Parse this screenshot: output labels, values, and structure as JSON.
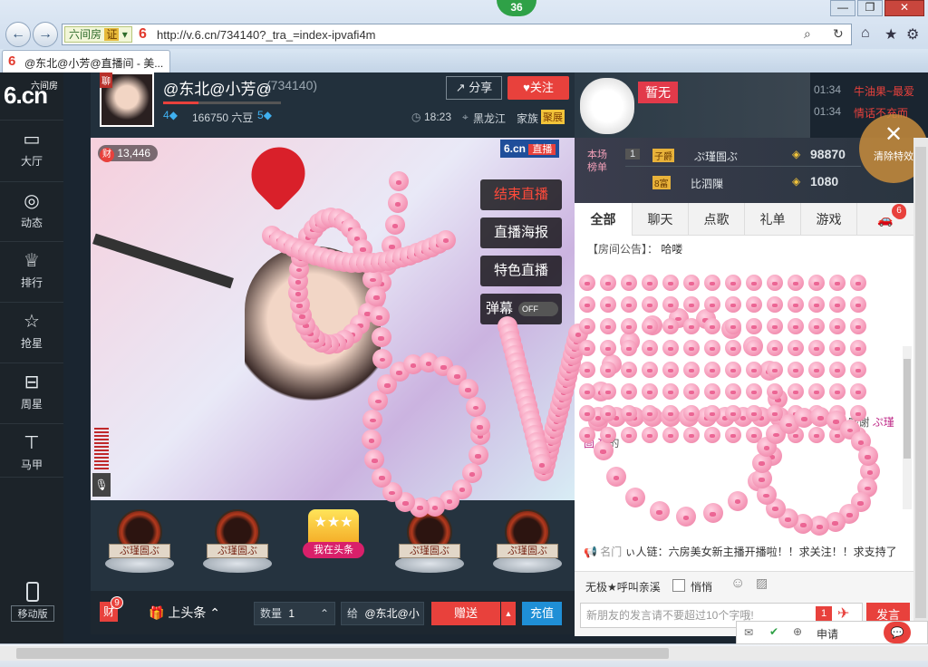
{
  "browser": {
    "badge_count": "36",
    "back_label": "←",
    "forward_label": "→",
    "site_id_label": "六间房",
    "site_id_cert": "证",
    "url": "http://v.6.cn/734140?_tra_=index-ipvafi4m",
    "tab_title": "@东北@小芳@直播间 - 美...",
    "window_controls": [
      "—",
      "❐",
      "✕"
    ]
  },
  "sidebar": {
    "logo_brand": "六间房",
    "logo_text": "6.cn",
    "items": [
      {
        "label": "大厅",
        "icon": "tv-icon"
      },
      {
        "label": "动态",
        "icon": "compass-icon"
      },
      {
        "label": "排行",
        "icon": "crown-icon"
      },
      {
        "label": "抢星",
        "icon": "star-icon"
      },
      {
        "label": "周星",
        "icon": "gift-bag-icon"
      },
      {
        "label": "马甲",
        "icon": "shirt-icon"
      }
    ],
    "mobile_label": "移动版"
  },
  "streamer": {
    "badge": "聊",
    "name": "@东北@小芳@",
    "room_id": "(734140)",
    "level_left": "4",
    "beans": "166750 六豆",
    "level_right": "5",
    "time": "18:23",
    "location": "黑龙江",
    "family_label": "家族",
    "family_badge": "聚展",
    "share_label": "分享",
    "follow_label": "关注"
  },
  "video": {
    "wealth_badge": "财",
    "wealth_count": "13,446",
    "logo": "6.cn",
    "live_tag": "直播",
    "buttons": [
      "结束直播",
      "直播海报",
      "特色直播"
    ],
    "danmu_label": "弹幕",
    "danmu_state": "OFF"
  },
  "gift_medals": [
    "ぷ瑾圄ぶ",
    "ぷ瑾圄ぶ",
    "我在头条",
    "ぷ瑾圄ぶ",
    "ぷ瑾圄ぶ"
  ],
  "bottom": {
    "wealth_badge": "财",
    "wealth_count": "9",
    "headline_label": "上头条",
    "qty_label": "数量",
    "qty_value": "1",
    "to_label": "给",
    "to_value": "@东北@小",
    "send_label": "赠送",
    "recharge_label": "充值"
  },
  "ranking": {
    "banner": "暂无",
    "title_line1": "本场",
    "title_line2": "榜单",
    "rows": [
      {
        "rank": "1",
        "badge": "子爵",
        "name": "ぷ瑾圄ぶ",
        "score": "98870"
      },
      {
        "rank": "",
        "badge": "8富",
        "name": "比泗隟",
        "score": "1080"
      }
    ],
    "close_label": "清除特效",
    "close_count": "6"
  },
  "ticker": [
    {
      "time": "01:34",
      "text": "牛油果~最爱"
    },
    {
      "time": "01:34",
      "text": "情话不充而"
    }
  ],
  "chat": {
    "tabs": [
      "全部",
      "聊天",
      "点歌",
      "礼单",
      "游戏"
    ],
    "car_count": "6",
    "announcement_label": "【房间公告】：",
    "announcement_text": "哈喽",
    "thanks_fragment": "00个，感谢",
    "thanks_name": "ぷ瑾",
    "second_line_name": "圄ぶ",
    "second_line_text": "的",
    "notice_name": "名门",
    "notice_text": "ぃ人链：六房美女新主播开播啦！！求关注！！求支持了",
    "target_user": "无极★呼叫亲溪",
    "whisper_label": "悄悄",
    "input_placeholder": "新朋友的发言请不要超过10个字哦!",
    "send_count": "1",
    "send_label": "发言",
    "apply_label": "申请"
  },
  "colors": {
    "accent_red": "#e8413c",
    "brand_blue": "#1f4e9a",
    "pig_pink": "#f59ab9"
  }
}
